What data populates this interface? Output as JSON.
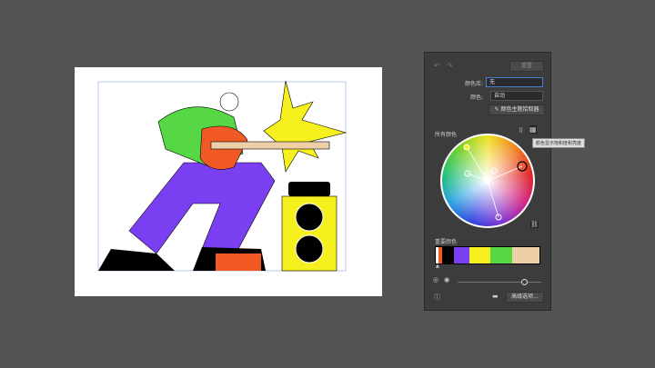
{
  "panel": {
    "reset_label": "重置",
    "library_label": "颜色库:",
    "library_value": "无",
    "colors_label": "颜色:",
    "colors_value": "自动",
    "theme_picker_label": "颜色主题拾取器",
    "all_colors_label": "所有颜色",
    "tooltip": "颜色显示饱和度和亮度",
    "prominent_label": "重要颜色",
    "advanced_label": "高级选项...",
    "swatches": [
      "#ffffff",
      "#f15a24",
      "#000000",
      "#7b3ff2",
      "#f5f01e",
      "#56d846",
      "#efcfa8"
    ],
    "icons": [
      "undo-icon",
      "redo-icon",
      "eyedropper-icon",
      "grid-icon",
      "wheel-icon",
      "link-icon",
      "info-icon",
      "folder-icon"
    ]
  }
}
